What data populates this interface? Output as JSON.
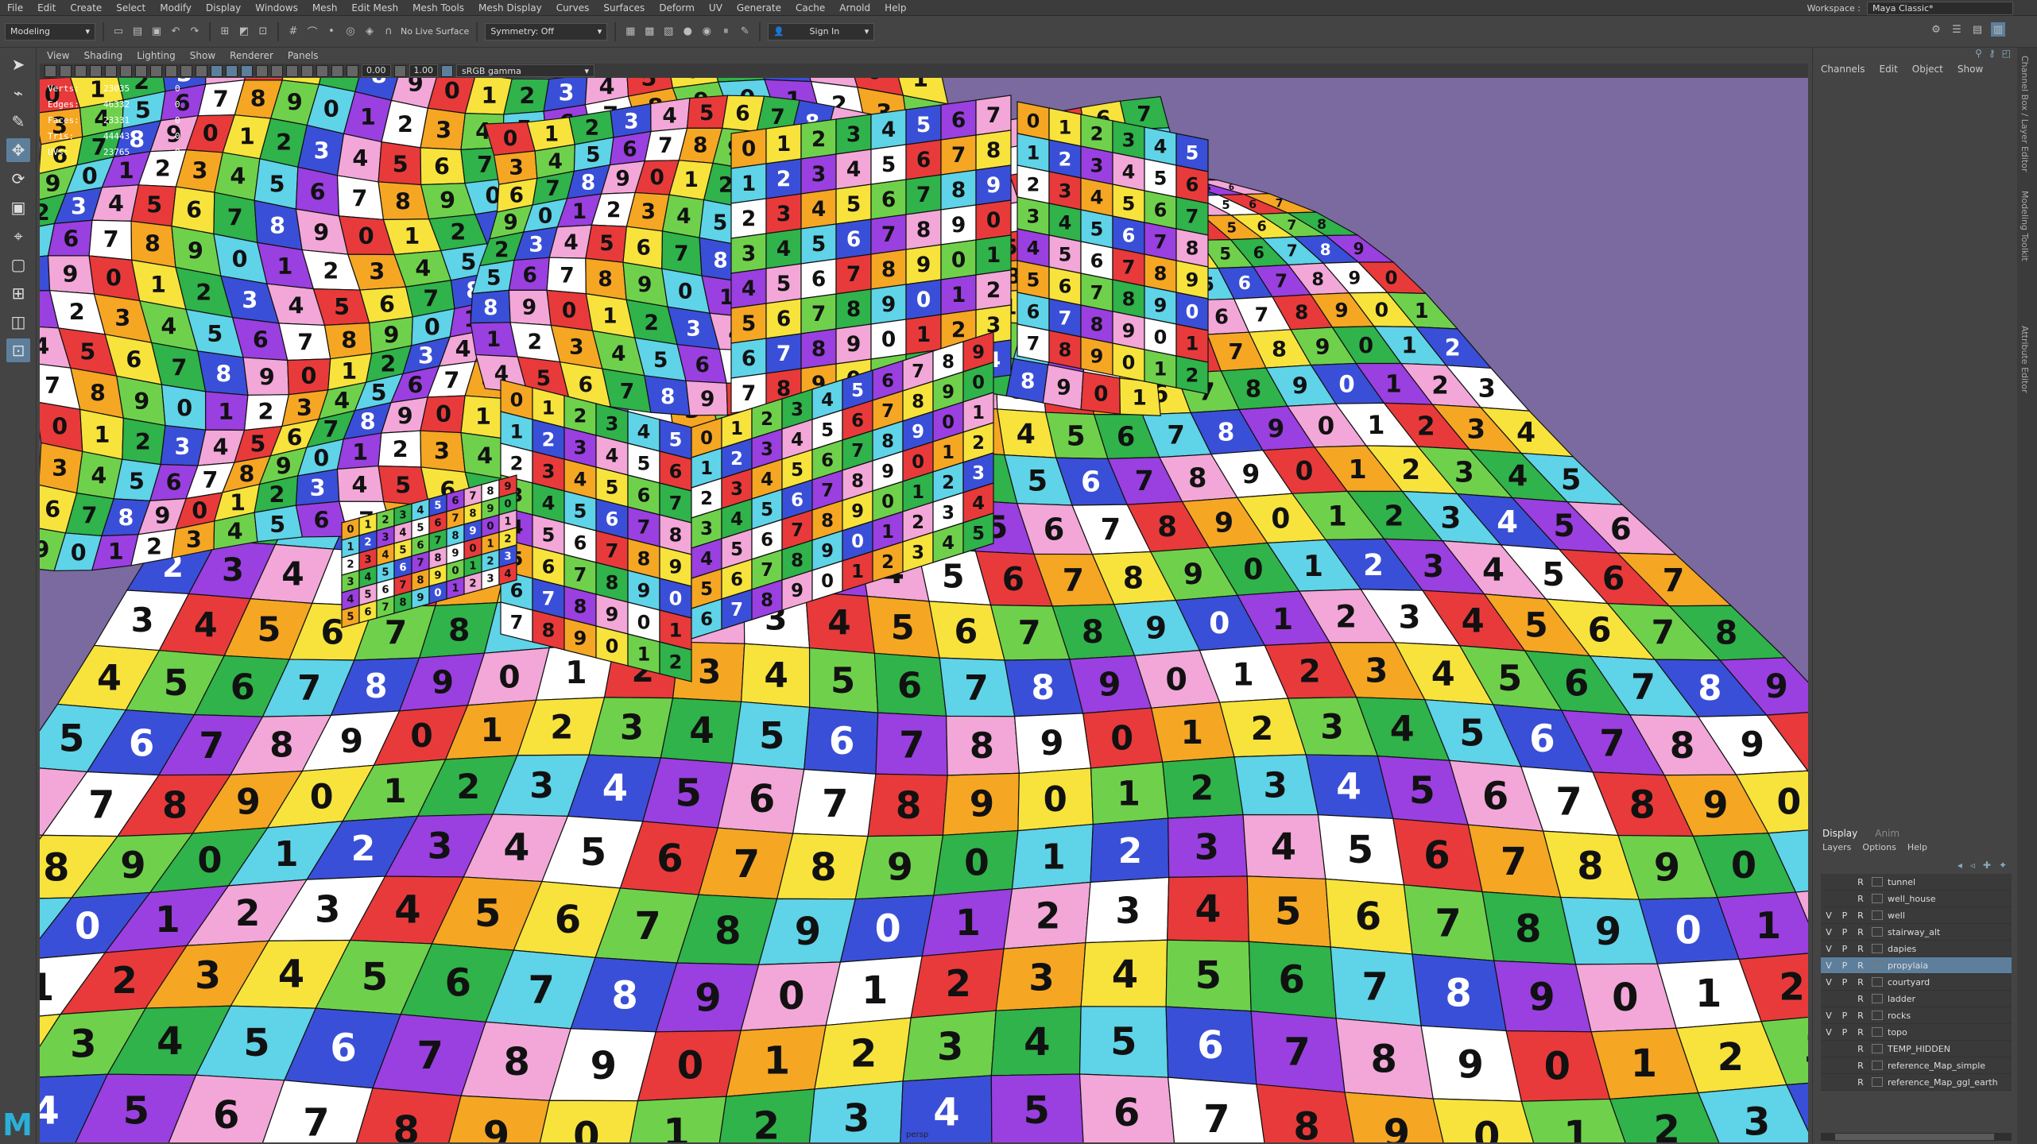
{
  "menubar": {
    "items": [
      "File",
      "Edit",
      "Create",
      "Select",
      "Modify",
      "Display",
      "Windows",
      "Mesh",
      "Edit Mesh",
      "Mesh Tools",
      "Mesh Display",
      "Curves",
      "Surfaces",
      "Deform",
      "UV",
      "Generate",
      "Cache",
      "Arnold",
      "Help"
    ],
    "workspace_label": "Workspace :",
    "workspace_value": "Maya Classic*"
  },
  "statusline": {
    "mode": "Modeling",
    "live_surface": "No Live Surface",
    "symmetry": "Symmetry: Off",
    "sign_in": "Sign In"
  },
  "viewport": {
    "menu": [
      "View",
      "Shading",
      "Lighting",
      "Show",
      "Renderer",
      "Panels"
    ],
    "exposure": "0.00",
    "gamma": "1.00",
    "color_space": "sRGB gamma",
    "camera": "persp",
    "hud": [
      {
        "label": "Verts:",
        "value": "23035",
        "sel": "0"
      },
      {
        "label": "Edges:",
        "value": "46332",
        "sel": "0"
      },
      {
        "label": "Faces:",
        "value": "23331",
        "sel": "0"
      },
      {
        "label": "Tris:",
        "value": "44443",
        "sel": "0"
      },
      {
        "label": "UVs:",
        "value": "23765",
        "sel": "0"
      }
    ]
  },
  "channel_box": {
    "menu": [
      "Channels",
      "Edit",
      "Object",
      "Show"
    ]
  },
  "side_tabs": [
    "Channel Box / Layer Editor",
    "Modeling Toolkit",
    "Attribute Editor"
  ],
  "layer_editor": {
    "tabs": [
      "Display",
      "Anim"
    ],
    "menu": [
      "Layers",
      "Options",
      "Help"
    ],
    "layers": [
      {
        "v": "",
        "p": "",
        "r": "R",
        "name": "tunnel",
        "selected": false
      },
      {
        "v": "",
        "p": "",
        "r": "R",
        "name": "well_house",
        "selected": false
      },
      {
        "v": "V",
        "p": "P",
        "r": "R",
        "name": "well",
        "selected": false
      },
      {
        "v": "V",
        "p": "P",
        "r": "R",
        "name": "stairway_alt",
        "selected": false
      },
      {
        "v": "V",
        "p": "P",
        "r": "R",
        "name": "dapies",
        "selected": false
      },
      {
        "v": "V",
        "p": "P",
        "r": "R",
        "name": "propylaia",
        "selected": true
      },
      {
        "v": "V",
        "p": "P",
        "r": "R",
        "name": "courtyard",
        "selected": false
      },
      {
        "v": "",
        "p": "",
        "r": "R",
        "name": "ladder",
        "selected": false
      },
      {
        "v": "V",
        "p": "P",
        "r": "R",
        "name": "rocks",
        "selected": false
      },
      {
        "v": "V",
        "p": "P",
        "r": "R",
        "name": "topo",
        "selected": false
      },
      {
        "v": "",
        "p": "",
        "r": "R",
        "name": "TEMP_HIDDEN",
        "selected": false
      },
      {
        "v": "",
        "p": "",
        "r": "R",
        "name": "reference_Map_simple",
        "selected": false
      },
      {
        "v": "",
        "p": "",
        "r": "R",
        "name": "reference_Map_ggl_earth",
        "selected": false
      }
    ]
  },
  "checker": {
    "colors": [
      "#e83a3a",
      "#f5a623",
      "#f7e33b",
      "#6fd14b",
      "#2fb34a",
      "#5fd3e8",
      "#3a4fd8",
      "#9a3fe0",
      "#f2a7d8",
      "#ffffff"
    ],
    "digits": [
      "0",
      "1",
      "2",
      "3",
      "4",
      "5",
      "6",
      "7",
      "8",
      "9"
    ]
  },
  "logo": "M"
}
